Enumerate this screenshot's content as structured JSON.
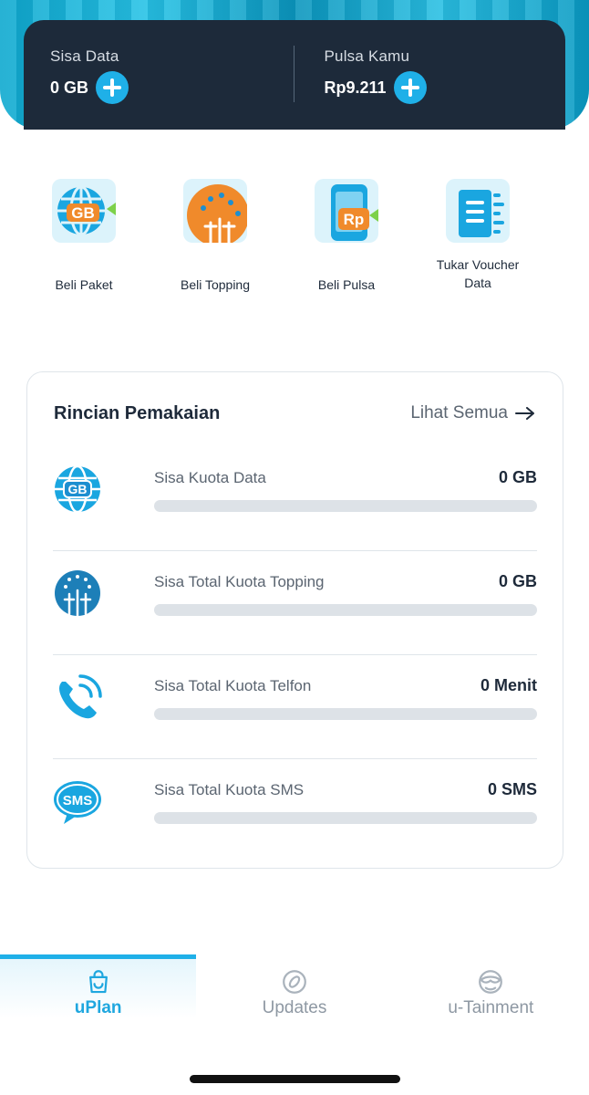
{
  "balance": {
    "data": {
      "label": "Sisa Data",
      "value": "0 GB"
    },
    "credit": {
      "label": "Pulsa Kamu",
      "value": "Rp9.211"
    }
  },
  "quick_menu": [
    {
      "label": "Beli Paket",
      "icon": "globe-gb-icon"
    },
    {
      "label": "Beli Topping",
      "icon": "topping-icon"
    },
    {
      "label": "Beli Pulsa",
      "icon": "phone-rp-icon"
    },
    {
      "label": "Tukar Voucher Data",
      "icon": "voucher-icon"
    }
  ],
  "usage": {
    "title": "Rincian Pemakaian",
    "see_all": "Lihat Semua",
    "rows": [
      {
        "label": "Sisa Kuota Data",
        "value": "0 GB",
        "icon": "globe-gb-icon",
        "fill": 0
      },
      {
        "label": "Sisa Total Kuota Topping",
        "value": "0 GB",
        "icon": "topping-icon",
        "fill": 0
      },
      {
        "label": "Sisa Total Kuota Telfon",
        "value": "0 Menit",
        "icon": "phone-call-icon",
        "fill": 0
      },
      {
        "label": "Sisa Total Kuota SMS",
        "value": "0 SMS",
        "icon": "sms-bubble-icon",
        "fill": 0
      }
    ]
  },
  "nav": [
    {
      "label": "uPlan",
      "icon": "shopping-bag-icon",
      "active": true
    },
    {
      "label": "Updates",
      "icon": "compass-icon",
      "active": false
    },
    {
      "label": "u-Tainment",
      "icon": "entertainment-icon",
      "active": false
    }
  ],
  "colors": {
    "accent": "#1fb0e8",
    "dark": "#1d2a3a",
    "track": "#dde2e7"
  }
}
